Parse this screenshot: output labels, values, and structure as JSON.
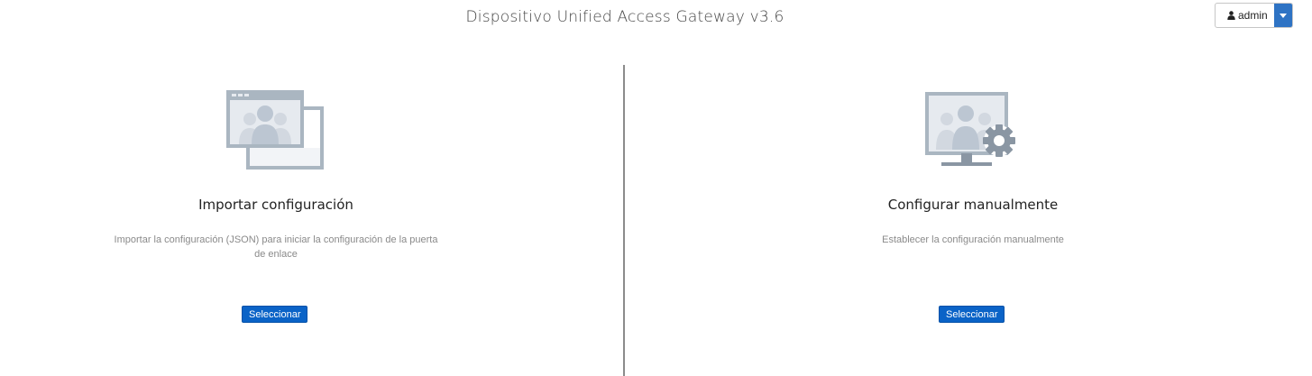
{
  "header": {
    "title": "Dispositivo Unified Access Gateway v3.6",
    "user_label": "admin"
  },
  "import_panel": {
    "icon": "import-windows-icon",
    "title": "Importar configuración",
    "description": "Importar la configuración (JSON) para iniciar la configuración de la puerta de enlace",
    "button_label": "Seleccionar"
  },
  "manual_panel": {
    "icon": "monitor-gear-icon",
    "title": "Configurar manualmente",
    "description": "Establecer la configuración manualmente",
    "button_label": "Seleccionar"
  },
  "colors": {
    "primary_button": "#0a63c7",
    "dropdown_accent": "#2e73c4",
    "icon_gray": "#a8b4bf"
  }
}
